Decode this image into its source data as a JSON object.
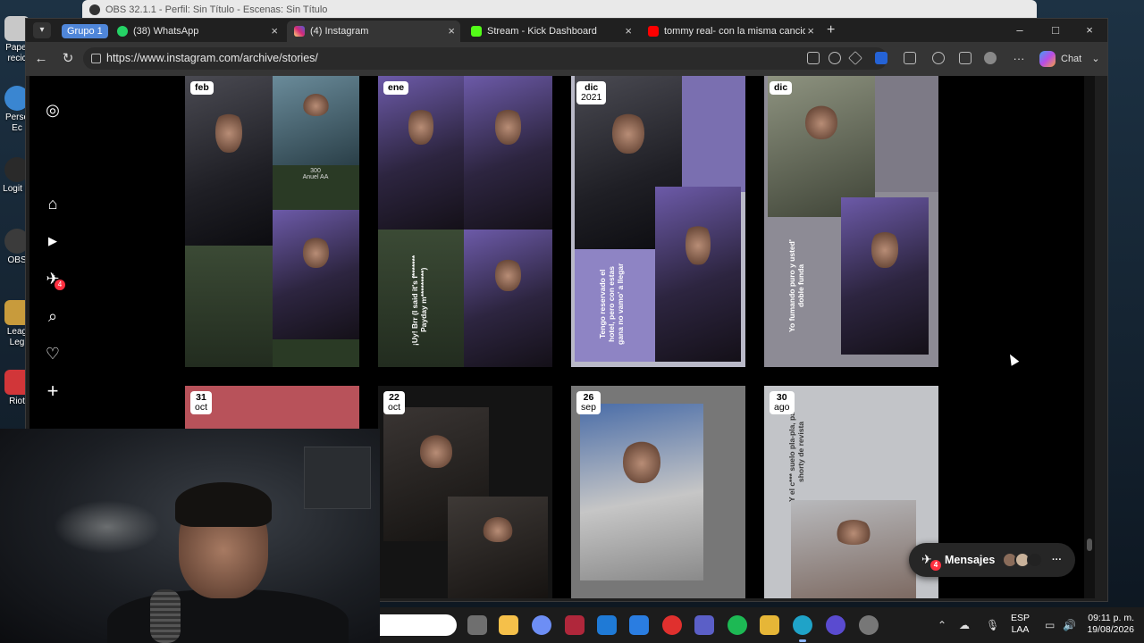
{
  "obs_window": {
    "title": "OBS 32.1.1 - Perfil: Sin Título - Escenas: Sin Título"
  },
  "desktop_icons": [
    {
      "label": "Papel recic",
      "color": "#c8c8c8"
    },
    {
      "label": "Perso Ec",
      "color": "#3a86d1"
    },
    {
      "label": "Logit H",
      "color": "#2a2a2a"
    },
    {
      "label": "OBS",
      "color": "#3b3b3b"
    },
    {
      "label": "Leag Leg",
      "color": "#c89b3c"
    },
    {
      "label": "Riot",
      "color": "#d13639"
    }
  ],
  "browser": {
    "tab_group_label": "Grupo 1",
    "tabs": [
      {
        "label": "(38) WhatsApp",
        "favicon_color": "#25d366",
        "badge": "38"
      },
      {
        "label": "(4) Instagram",
        "favicon_color": "#d62976"
      },
      {
        "label": "Stream - Kick Dashboard",
        "favicon_color": "#53fc18"
      },
      {
        "label": "tommy real- con la misma cancion",
        "favicon_color": "#ff0000"
      }
    ],
    "new_tab_symbol": "+",
    "close_symbol": "×",
    "window_controls": {
      "minimize": "–",
      "maximize": "□",
      "close": "×"
    },
    "url": "https://www.instagram.com/archive/stories/",
    "chat_label": "Chat"
  },
  "instagram": {
    "sidebar_icons": [
      "instagram-logo-icon",
      "home-icon",
      "reels-icon",
      "messages-icon",
      "search-icon",
      "heart-icon",
      "create-icon"
    ],
    "sidebar_glyphs": [
      "◎",
      "⌂",
      "▶",
      "✈",
      "⌕",
      "♡",
      "+"
    ],
    "messages_badge": "4",
    "stories": [
      {
        "date": "feb",
        "year": "",
        "song_title": "300",
        "song_artist": "Anuel AA",
        "caption": ""
      },
      {
        "date": "ene",
        "year": "",
        "song_title": "",
        "song_artist": "",
        "caption": "¡Uy! Brr (I said it's f******* Payday m*********)"
      },
      {
        "date": "dic",
        "year": "2021",
        "song_title": "",
        "song_artist": "",
        "caption": "Tengo reservado el hotel, pero con estas gana no vamo' a llegar"
      },
      {
        "date": "dic",
        "year": "",
        "song_title": "",
        "song_artist": "",
        "caption": "Yo fumando puro y usted' doble funda"
      },
      {
        "date": "31",
        "year": "oct",
        "song_title": "",
        "song_artist": "",
        "caption": ""
      },
      {
        "date": "22",
        "year": "oct",
        "song_title": "",
        "song_artist": "",
        "caption": ""
      },
      {
        "date": "26",
        "year": "sep",
        "song_title": "",
        "song_artist": "",
        "caption": ""
      },
      {
        "date": "30",
        "year": "ago",
        "song_title": "",
        "song_artist": "",
        "caption": "Y el c*** suelo pla-pla, pa' la shorty de revista"
      }
    ],
    "messages_label": "Mensajes",
    "messages_count": "4",
    "messages_more": "···"
  },
  "taskbar": {
    "apps": [
      {
        "name": "task-view",
        "color": "#6f6f6f"
      },
      {
        "name": "file-explorer",
        "color": "#f5c04a"
      },
      {
        "name": "copilot",
        "color": "#6d8ef5"
      },
      {
        "name": "app-red",
        "color": "#b0273b"
      },
      {
        "name": "outlook",
        "color": "#1f7ad6"
      },
      {
        "name": "store",
        "color": "#2a7de1"
      },
      {
        "name": "app-torch",
        "color": "#e0302e"
      },
      {
        "name": "teams",
        "color": "#5b5fc7"
      },
      {
        "name": "spotify",
        "color": "#1db954"
      },
      {
        "name": "app-yellow",
        "color": "#e6b637"
      },
      {
        "name": "edge",
        "color": "#1fa3c8"
      },
      {
        "name": "obs",
        "color": "#5a4bd0"
      },
      {
        "name": "settings",
        "color": "#777777"
      }
    ],
    "tray_expand": "⌃",
    "language": {
      "code": "ESP",
      "layout": "LAA"
    },
    "time": "09:11 p. m.",
    "date": "19/08/2026"
  }
}
